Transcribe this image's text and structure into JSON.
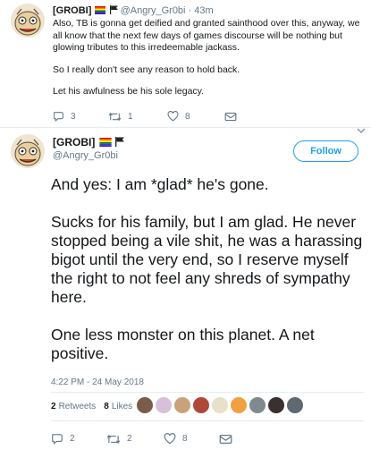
{
  "tweet1": {
    "name": "[GROBI]",
    "handle": "@Angry_Gr0bi",
    "separator": "·",
    "time": "43m",
    "paragraphs": [
      "Also, TB is gonna get deified and granted sainthood over this, anyway, we all know that the next few days of games discourse will be nothing but glowing tributes to this irredeemable jackass.",
      "So I really don't see any reason to hold back.",
      "Let his awfulness be his sole legacy."
    ],
    "actions": {
      "replies": "3",
      "retweets": "1",
      "likes": "8"
    }
  },
  "tweet2": {
    "name": "[GROBI]",
    "handle": "@Angry_Gr0bi",
    "follow_label": "Follow",
    "paragraphs": [
      "And yes: I am *glad* he's gone.",
      "Sucks for his family, but I am glad. He never stopped being a vile shit, he was a harassing bigot until the very end, so I reserve myself the right to not feel any shreds of sympathy here.",
      "One less monster on this planet. A net positive."
    ],
    "timestamp": "4:22 PM - 24 May 2018",
    "stats": {
      "retweets_count": "2",
      "retweets_label": "Retweets",
      "likes_count": "8",
      "likes_label": "Likes"
    },
    "liker_colors": [
      "#7a5c4a",
      "#d8c0d8",
      "#c9a27a",
      "#b0483a",
      "#e8e0c8",
      "#f0a040",
      "#808890",
      "#3a3030",
      "#606870"
    ],
    "actions": {
      "replies": "2",
      "retweets": "2",
      "likes": "8"
    }
  },
  "colors": {
    "accent": "#1da1f2",
    "muted": "#657786",
    "text": "#14171a",
    "divider": "#e6ecf0"
  },
  "icons": {
    "flags": [
      "rainbow-flag-icon",
      "black-flag-icon"
    ],
    "reply": "reply-icon",
    "retweet": "retweet-icon",
    "like": "heart-icon",
    "dm": "envelope-icon",
    "more": "chevron-down-icon"
  }
}
